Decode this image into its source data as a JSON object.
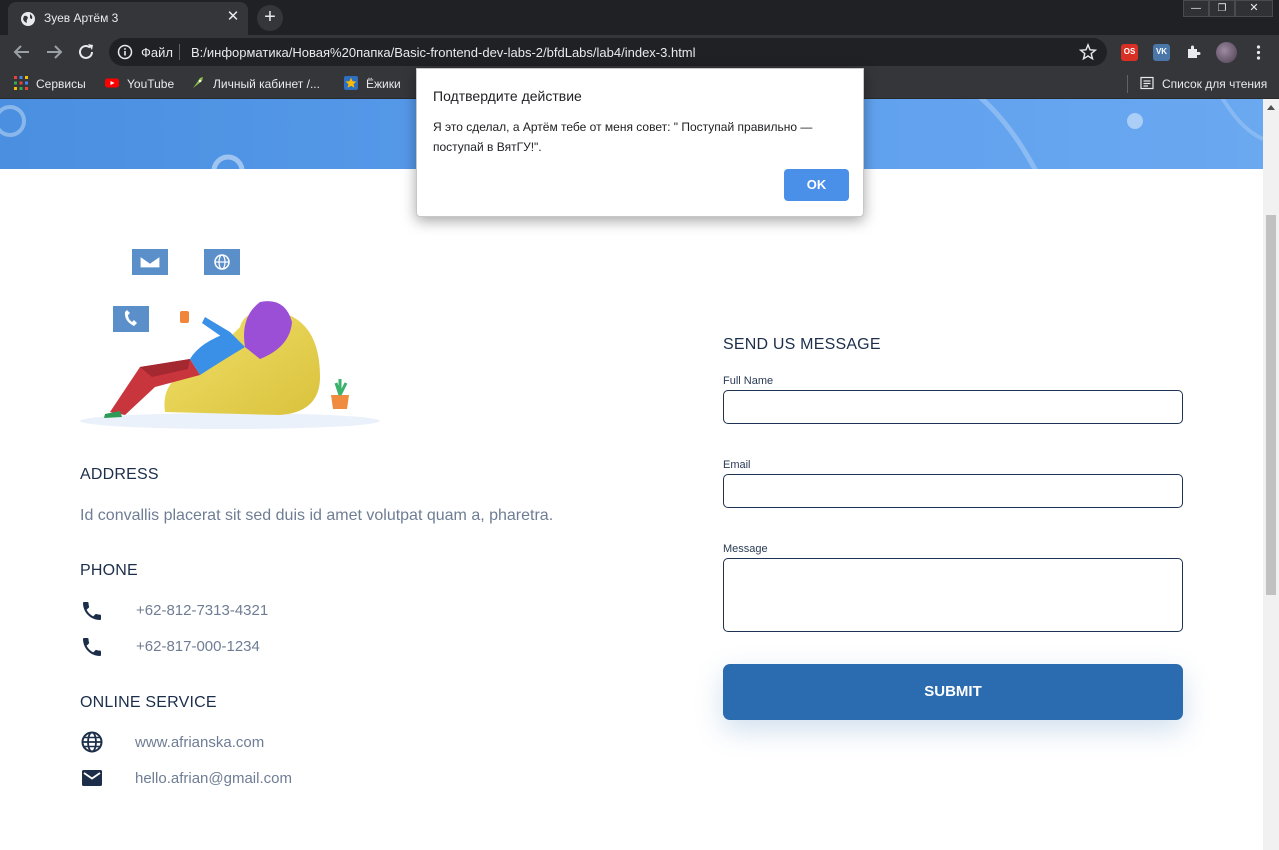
{
  "browser": {
    "tab_title": "Зуев Артём 3",
    "tab_close": "✕",
    "new_tab": "+",
    "window_controls": [
      "—",
      "❐",
      "✕"
    ],
    "omnibox_scheme_label": "Файл",
    "url": "B:/информатика/Новая%20папка/Basic-frontend-dev-labs-2/bfdLabs/lab4/index-3.html",
    "bookmarks": [
      "Сервисы",
      "YouTube",
      "Личный кабинет /...",
      "Ёжики"
    ],
    "reading_list": "Список для чтения"
  },
  "page": {
    "address": {
      "title": "ADDRESS",
      "text": "Id convallis placerat sit sed duis id amet volutpat quam a, pharetra."
    },
    "phone": {
      "title": "PHONE",
      "numbers": [
        "+62-812-7313-4321",
        "+62-817-000-1234"
      ]
    },
    "online": {
      "title": "ONLINE SERVICE",
      "website": "www.afrianska.com",
      "email": "hello.afrian@gmail.com"
    },
    "form": {
      "title": "SEND US MESSAGE",
      "full_name_label": "Full Name",
      "email_label": "Email",
      "message_label": "Message",
      "submit_label": "SUBMIT"
    }
  },
  "dialog": {
    "title": "Подтвердите действие",
    "message": "Я это сделал, а Артём тебе от меня совет: \" Поступай правильно — поступай в ВятГУ!\".",
    "ok_label": "OK"
  },
  "colors": {
    "accent": "#2b6cb0",
    "heading": "#1c2e4a",
    "body_text": "#6f7d94",
    "dialog_button": "#4a8fe8"
  }
}
